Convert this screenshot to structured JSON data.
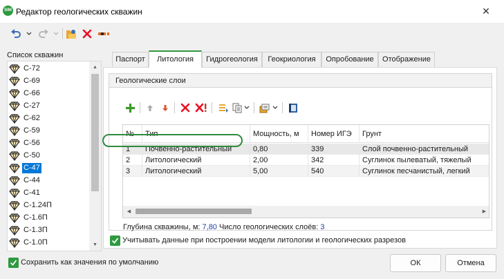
{
  "window": {
    "title": "Редактор геологических скважин",
    "app_icon_text": "SIM",
    "close_glyph": "✕"
  },
  "toolbar": {
    "undo_icon": "undo-icon",
    "redo_icon": "redo-icon",
    "dropdown_icon": "chevron-down-icon",
    "open_icon": "open-folder-icon",
    "delete_icon": "delete-icon",
    "well_icon": "well-marker-icon"
  },
  "well_list": {
    "label": "Список скважин",
    "items": [
      "С-72",
      "С-69",
      "С-66",
      "С-27",
      "С-62",
      "С-59",
      "С-56",
      "С-50",
      "С-47",
      "С-44",
      "С-41",
      "С-1.24П",
      "С-1.6П",
      "С-1.3П",
      "С-1.0П"
    ],
    "selected": "С-47"
  },
  "tabs": [
    "Паспорт",
    "Литология",
    "Гидрогеология",
    "Геокриология",
    "Опробование",
    "Отображение"
  ],
  "active_tab": "Литология",
  "layers": {
    "group_title": "Геологические слои",
    "columns": [
      "№",
      "Тип",
      "Мощность, м",
      "Номер ИГЭ",
      "Грунт"
    ],
    "rows": [
      {
        "num": "1",
        "type": "Почвенно-растительный",
        "thickness": "0,80",
        "ige": "339",
        "soil": "Слой почвенно-растительный"
      },
      {
        "num": "2",
        "type": "Литологический",
        "thickness": "2,00",
        "ige": "342",
        "soil": "Суглинок пылеватый, тяжелый"
      },
      {
        "num": "3",
        "type": "Литологический",
        "thickness": "5,00",
        "ige": "540",
        "soil": "Суглинок песчанистый, легкий"
      }
    ],
    "depth_label": "Глубина скважины, м:",
    "depth_value": "7,80",
    "count_label": "Число геологических слоёв:",
    "count_value": "3"
  },
  "options": {
    "use_data_label": "Учитывать данные при построении модели литологии и геологических разрезов",
    "use_data_checked": true,
    "save_default_label": "Сохранить как значения по умолчанию",
    "save_default_checked": true
  },
  "buttons": {
    "ok": "ОК",
    "cancel": "Отмена"
  },
  "colors": {
    "accent": "#2e9a3f",
    "selection": "#0078d7",
    "delete_red": "#e81123",
    "add_green": "#3a9a2a",
    "value_blue": "#1f3fa8"
  }
}
